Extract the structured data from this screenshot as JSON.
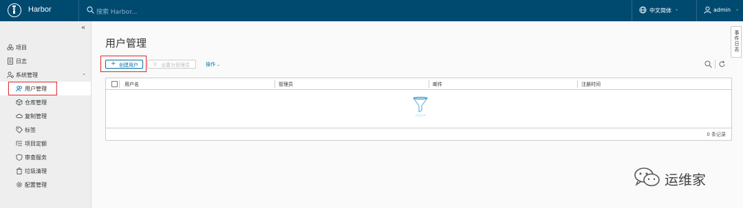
{
  "header": {
    "brand": "Harbor",
    "logo_icon": "harbor-lighthouse-icon",
    "search_placeholder": "搜索 Harbor...",
    "language": "中文简体",
    "user": "admin",
    "bg_color": "#004a70"
  },
  "sidebar": {
    "collapse_icon": "«",
    "items": [
      {
        "label": "项目",
        "icon": "projects-icon"
      },
      {
        "label": "日志",
        "icon": "logs-icon"
      },
      {
        "label": "系统管理",
        "icon": "admin-icon"
      },
      {
        "label": "用户管理",
        "icon": "users-icon",
        "active": true
      },
      {
        "label": "仓库管理",
        "icon": "registry-icon"
      },
      {
        "label": "复制管理",
        "icon": "replication-icon"
      },
      {
        "label": "标签",
        "icon": "tag-icon"
      },
      {
        "label": "项目定额",
        "icon": "quota-icon"
      },
      {
        "label": "审查服务",
        "icon": "shield-icon"
      },
      {
        "label": "垃圾清理",
        "icon": "trash-icon"
      },
      {
        "label": "配置管理",
        "icon": "gear-icon"
      }
    ]
  },
  "main": {
    "title": "用户管理",
    "new_user_label": "创建用户",
    "set_admin_label": "设置为管理员",
    "actions_label": "操作",
    "table": {
      "columns": [
        "用户名",
        "管理员",
        "邮件",
        "注册时间"
      ],
      "rows": [],
      "footer": "0 条记录"
    }
  },
  "event_log_label": "事件日志",
  "watermark": "运维家",
  "accent_color": "#0072a3",
  "highlight_color": "#e0262b"
}
